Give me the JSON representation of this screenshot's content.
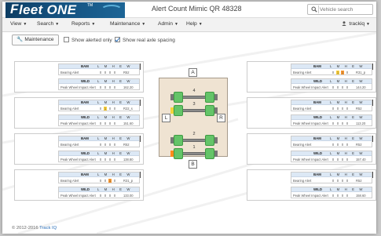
{
  "app": {
    "logo_text": "leet ONE",
    "logo_mark": "F",
    "logo_tm": "TM",
    "title": "Alert Count Mimic QR 48328"
  },
  "search": {
    "placeholder": "Vehicle search"
  },
  "menu": [
    {
      "label": "View"
    },
    {
      "label": "Search"
    },
    {
      "label": "Reports"
    },
    {
      "label": "Maintenance"
    },
    {
      "label": "Admin"
    },
    {
      "label": "Help"
    }
  ],
  "user": {
    "name": "trackiq"
  },
  "controls": {
    "maintenance_button": "Maintenance",
    "show_alerted_only": {
      "label": "Show alerted only",
      "checked": false
    },
    "show_real_axle_spacing": {
      "label": "Show real axle spacing",
      "checked": true
    }
  },
  "severity_headers": "L M H E W",
  "panels": [
    {
      "id": "L4",
      "axle": "4",
      "bam": {
        "title": "BAM",
        "row_label": "Bearing Alert",
        "cells": [
          "0",
          "0",
          "0",
          "0"
        ],
        "cell_colors": [
          "",
          "",
          "",
          ""
        ],
        "value": "R52"
      },
      "wild": {
        "title": "WILD",
        "row_label": "Peak Wheel Impact Alert",
        "cells": [
          "0",
          "0",
          "0",
          "0"
        ],
        "cell_colors": [
          "",
          "",
          "",
          ""
        ],
        "value": "162.20"
      }
    },
    {
      "id": "L3",
      "axle": "3",
      "bam": {
        "title": "BAM",
        "row_label": "Bearing Alert",
        "cells": [
          "0",
          "1",
          "0",
          "0"
        ],
        "cell_colors": [
          "",
          "y",
          "",
          ""
        ],
        "value": "R22_s"
      },
      "wild": {
        "title": "WILD",
        "row_label": "Peak Wheel Impact Alert",
        "cells": [
          "0",
          "0",
          "0",
          "0"
        ],
        "cell_colors": [
          "",
          "",
          "",
          ""
        ],
        "value": "151.60"
      }
    },
    {
      "id": "L2",
      "axle": "2",
      "bam": {
        "title": "BAM",
        "row_label": "Bearing Alert",
        "cells": [
          "0",
          "0",
          "0",
          "0"
        ],
        "cell_colors": [
          "",
          "",
          "",
          ""
        ],
        "value": "R52"
      },
      "wild": {
        "title": "WILD",
        "row_label": "Peak Wheel Impact Alert",
        "cells": [
          "0",
          "0",
          "0",
          "0"
        ],
        "cell_colors": [
          "",
          "",
          "",
          ""
        ],
        "value": "138.80"
      }
    },
    {
      "id": "L1",
      "axle": "1",
      "bam": {
        "title": "BAM",
        "row_label": "Bearing Alert",
        "cells": [
          "0",
          "0",
          "1",
          "0"
        ],
        "cell_colors": [
          "",
          "",
          "o",
          ""
        ],
        "value": "R31_p"
      },
      "wild": {
        "title": "WILD",
        "row_label": "Peak Wheel Impact Alert",
        "cells": [
          "0",
          "0",
          "0",
          "0"
        ],
        "cell_colors": [
          "",
          "",
          "",
          ""
        ],
        "value": "133.00"
      }
    },
    {
      "id": "R4",
      "axle": "4",
      "bam": {
        "title": "BAM",
        "row_label": "Bearing Alert",
        "cells": [
          "0",
          "1",
          "1",
          "0"
        ],
        "cell_colors": [
          "",
          "y",
          "o",
          ""
        ],
        "value": "R31_p"
      },
      "wild": {
        "title": "WILD",
        "row_label": "Peak Wheel Impact Alert",
        "cells": [
          "0",
          "0",
          "0",
          "0"
        ],
        "cell_colors": [
          "",
          "",
          "",
          ""
        ],
        "value": "144.20"
      }
    },
    {
      "id": "R3",
      "axle": "3",
      "bam": {
        "title": "BAM",
        "row_label": "Bearing Alert",
        "cells": [
          "0",
          "0",
          "0",
          "0"
        ],
        "cell_colors": [
          "",
          "",
          "",
          ""
        ],
        "value": "R52"
      },
      "wild": {
        "title": "WILD",
        "row_label": "Peak Wheel Impact Alert",
        "cells": [
          "0",
          "0",
          "0",
          "0"
        ],
        "cell_colors": [
          "",
          "",
          "",
          ""
        ],
        "value": "113.20"
      }
    },
    {
      "id": "R2",
      "axle": "2",
      "bam": {
        "title": "BAM",
        "row_label": "Bearing Alert",
        "cells": [
          "0",
          "0",
          "0",
          "0"
        ],
        "cell_colors": [
          "",
          "",
          "",
          ""
        ],
        "value": "R52"
      },
      "wild": {
        "title": "WILD",
        "row_label": "Peak Wheel Impact Alert",
        "cells": [
          "0",
          "0",
          "0",
          "0"
        ],
        "cell_colors": [
          "",
          "",
          "",
          ""
        ],
        "value": "157.40"
      }
    },
    {
      "id": "R1",
      "axle": "1",
      "bam": {
        "title": "BAM",
        "row_label": "Bearing Alert",
        "cells": [
          "0",
          "0",
          "0",
          "0"
        ],
        "cell_colors": [
          "",
          "",
          "",
          ""
        ],
        "value": "R52"
      },
      "wild": {
        "title": "WILD",
        "row_label": "Peak Wheel Impact Alert",
        "cells": [
          "0",
          "0",
          "0",
          "0"
        ],
        "cell_colors": [
          "",
          "",
          "",
          ""
        ],
        "value": "158.60"
      }
    }
  ],
  "diagram": {
    "top_tag": "A",
    "bottom_tag": "B",
    "left_tag": "L",
    "right_tag": "R",
    "axles": [
      {
        "label": "4",
        "left_cap": "#777777",
        "right_cap": "#777777"
      },
      {
        "label": "3",
        "left_cap": "#f2d33a",
        "right_cap": "#777777"
      },
      {
        "label": "2",
        "left_cap": "#777777",
        "right_cap": "#777777"
      },
      {
        "label": "1",
        "left_cap": "#ff8c1a",
        "right_cap": "#777777"
      }
    ]
  },
  "colors": {
    "accent": "#2a6fba",
    "wheel": "#64c468",
    "yellow_alert": "#ffd23a",
    "orange_alert": "#ff9a2e",
    "header_blue": "#dce8f5"
  },
  "footer": {
    "copyright": "© 2012-2016",
    "link": "Track IQ"
  }
}
